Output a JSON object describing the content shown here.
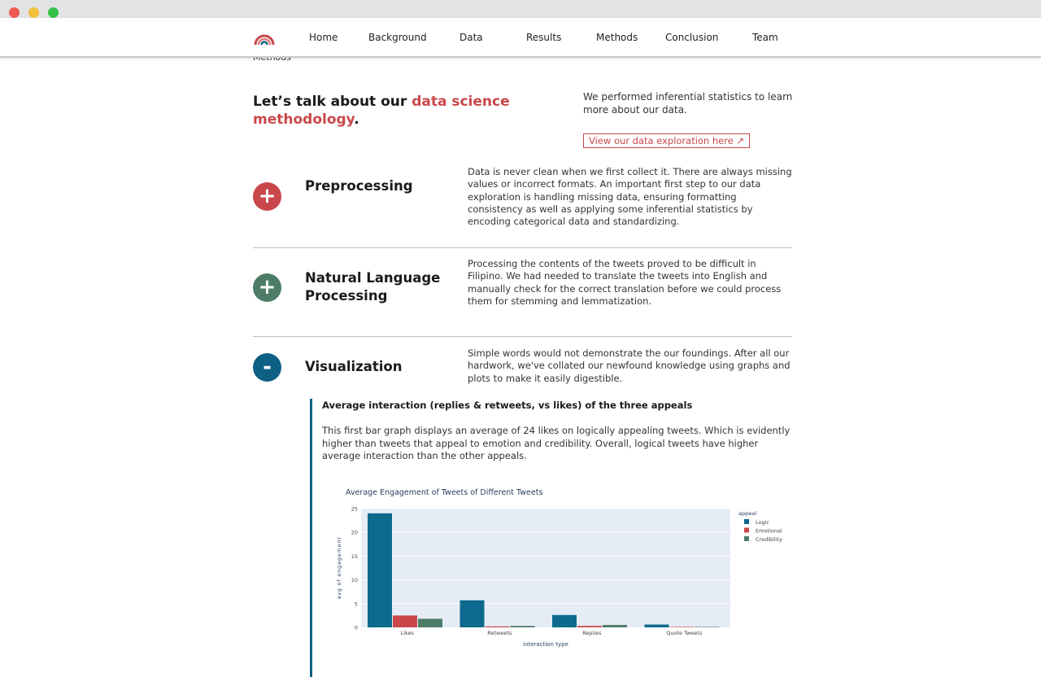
{
  "nav": {
    "links": [
      "Home",
      "Background",
      "Data",
      "Results",
      "Methods",
      "Conclusion",
      "Team"
    ]
  },
  "ghost_label": "Methods",
  "hero": {
    "title_prefix": "Let’s talk about our ",
    "title_accent": "data science methodology",
    "title_suffix": ".",
    "text": "We performed inferential statistics to learn more about our data.",
    "button_label": "View our data exploration here ↗"
  },
  "sections": [
    {
      "symbol": "+",
      "title": "Preprocessing",
      "color": "#c9474a",
      "description": "Data is never clean when we first collect it. There are always missing values or incorrect formats. An important first step to our data exploration is handling missing data, ensuring formatting consistency as well as applying some inferential statistics by encoding categorical data and standardizing."
    },
    {
      "symbol": "+",
      "title": "Natural Language Processing",
      "color": "#4d7c67",
      "description": "Processing the contents of the tweets proved to be difficult in Filipino. We had needed to translate the tweets into English and manually check for the correct translation before we could process them for stemming and lemmatization."
    },
    {
      "symbol": "-",
      "title": "Visualization",
      "color": "#0d5f84",
      "description": "Simple words would not demonstrate the our foundings. After all our hardwork, we've collated our newfound knowledge using graphs and plots to make it easily digestible."
    }
  ],
  "visualization": {
    "subtitle": "Average interaction (replies & retweets, vs likes) of the three appeals",
    "text": "This first bar graph displays an average of 24 likes on logically appealing tweets. Which is evidently higher than tweets that appeal to emotion and credibility. Overall, logical tweets have higher average interaction than the other appeals."
  },
  "chart_data": {
    "type": "bar",
    "title": "Average Engagement of Tweets of Different Tweets",
    "xlabel": "interaction type",
    "ylabel": "avg of engagement",
    "categories": [
      "Likes",
      "Retweets",
      "Replies",
      "Quote Tweets"
    ],
    "ylim": [
      0,
      25
    ],
    "yticks": [
      0,
      5,
      10,
      15,
      20,
      25
    ],
    "legend_title": "appeal",
    "legend_position": "right",
    "grid": true,
    "series": [
      {
        "name": "Logic",
        "color": "#0d6a8e",
        "values": [
          24,
          5.7,
          2.6,
          0.6
        ]
      },
      {
        "name": "Emotional",
        "color": "#c9474a",
        "values": [
          2.5,
          0.2,
          0.3,
          0.1
        ]
      },
      {
        "name": "Credibility",
        "color": "#4d7c67",
        "values": [
          1.8,
          0.3,
          0.5,
          0.1
        ]
      }
    ]
  }
}
